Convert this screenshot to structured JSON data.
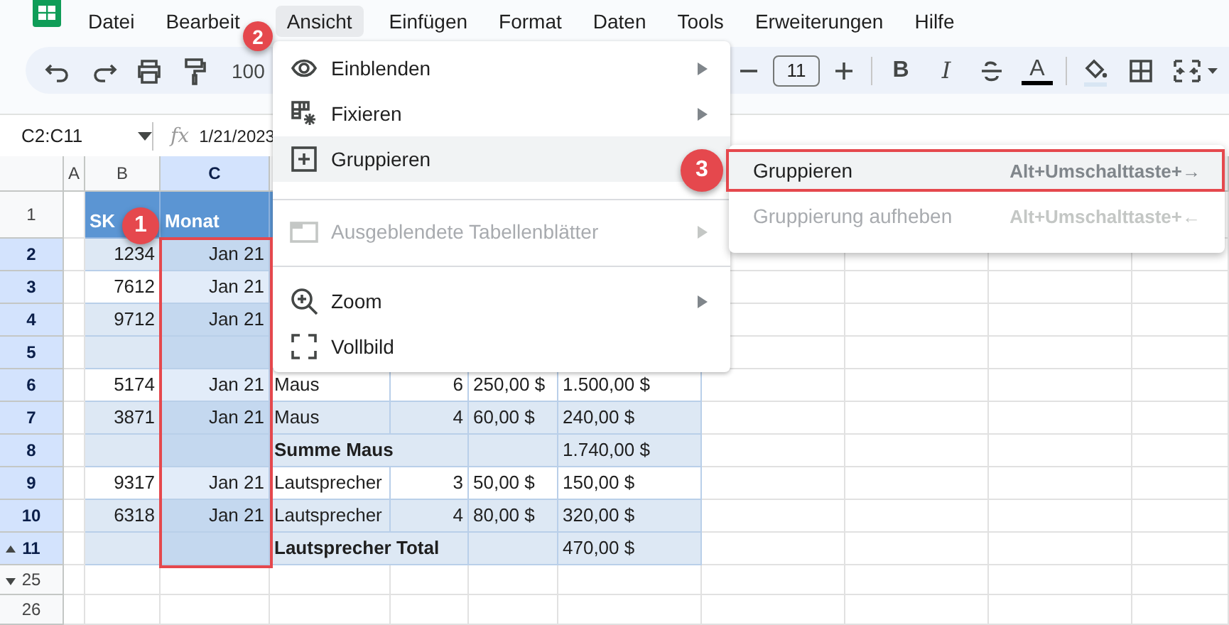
{
  "menubar": {
    "items": [
      {
        "label": "Datei",
        "selected": false
      },
      {
        "label": "Bearbeit",
        "selected": false
      },
      {
        "label": "Ansicht",
        "selected": true
      },
      {
        "label": "Einfügen",
        "selected": false
      },
      {
        "label": "Format",
        "selected": false
      },
      {
        "label": "Daten",
        "selected": false
      },
      {
        "label": "Tools",
        "selected": false
      },
      {
        "label": "Erweiterungen",
        "selected": false
      },
      {
        "label": "Hilfe",
        "selected": false
      }
    ]
  },
  "toolbar": {
    "zoom": "100",
    "font_size": "11",
    "bold": "B",
    "italic": "I",
    "text_color": "A"
  },
  "formula_bar": {
    "name_box": "C2:C11",
    "function_label": "fx",
    "value": "1/21/2023"
  },
  "sheet": {
    "columns": [
      {
        "label": "A",
        "selected": false
      },
      {
        "label": "B",
        "selected": false
      },
      {
        "label": "C",
        "selected": true
      }
    ],
    "rows": [
      {
        "number": "1",
        "kind": "header",
        "selected": false,
        "cells": {
          "B": "SK",
          "C": "Monat"
        }
      },
      {
        "number": "2",
        "kind": "item",
        "selected": true,
        "shaded": true,
        "cells": {
          "B": "1234",
          "C": "Jan 21"
        }
      },
      {
        "number": "3",
        "kind": "item",
        "selected": true,
        "shaded": false,
        "cells": {
          "B": "7612",
          "C": "Jan 21"
        }
      },
      {
        "number": "4",
        "kind": "item",
        "selected": true,
        "shaded": true,
        "cells": {
          "B": "9712",
          "C": "Jan 21"
        }
      },
      {
        "number": "5",
        "kind": "total",
        "selected": true,
        "shaded": true,
        "cells": {}
      },
      {
        "number": "6",
        "kind": "item",
        "selected": true,
        "shaded": false,
        "cells": {
          "B": "5174",
          "C": "Jan 21",
          "D": "Maus",
          "E": "6",
          "F": "250,00 $",
          "G": "1.500,00 $"
        }
      },
      {
        "number": "7",
        "kind": "item",
        "selected": true,
        "shaded": true,
        "cells": {
          "B": "3871",
          "C": "Jan 21",
          "D": "Maus",
          "E": "4",
          "F": "60,00 $",
          "G": "240,00 $"
        }
      },
      {
        "number": "8",
        "kind": "total",
        "selected": true,
        "shaded": true,
        "cells": {
          "D": "Summe Maus",
          "G": "1.740,00 $"
        }
      },
      {
        "number": "9",
        "kind": "item",
        "selected": true,
        "shaded": false,
        "cells": {
          "B": "9317",
          "C": "Jan 21",
          "D": "Lautsprecher",
          "E": "3",
          "F": "50,00 $",
          "G": "150,00 $"
        }
      },
      {
        "number": "10",
        "kind": "item",
        "selected": true,
        "shaded": true,
        "cells": {
          "B": "6318",
          "C": "Jan 21",
          "D": "Lautsprecher",
          "E": "4",
          "F": "80,00 $",
          "G": "320,00 $"
        }
      },
      {
        "number": "11",
        "kind": "total",
        "selected": true,
        "shaded": true,
        "group_expanded": true,
        "cells": {
          "D": "Lautsprecher Total",
          "G": "470,00 $"
        }
      },
      {
        "number": "25",
        "kind": "plain",
        "selected": false,
        "group_expanded": false,
        "cells": {}
      },
      {
        "number": "26",
        "kind": "plain",
        "selected": false,
        "cells": {}
      }
    ]
  },
  "view_menu": {
    "items": [
      {
        "kind": "item",
        "label": "Einblenden",
        "has_submenu": true,
        "disabled": false,
        "selected": false
      },
      {
        "kind": "item",
        "label": "Fixieren",
        "has_submenu": true,
        "disabled": false,
        "selected": false
      },
      {
        "kind": "item",
        "label": "Gruppieren",
        "has_submenu": false,
        "disabled": false,
        "selected": true
      },
      {
        "kind": "divider"
      },
      {
        "kind": "item",
        "label": "Ausgeblendete Tabellenblätter",
        "has_submenu": true,
        "disabled": true,
        "selected": false
      },
      {
        "kind": "divider"
      },
      {
        "kind": "item",
        "label": "Zoom",
        "has_submenu": true,
        "disabled": false,
        "selected": false
      },
      {
        "kind": "item",
        "label": "Vollbild",
        "has_submenu": false,
        "disabled": false,
        "selected": false
      }
    ]
  },
  "group_submenu": {
    "items": [
      {
        "label": "Gruppieren",
        "shortcut": "Alt+Umschalttaste+→",
        "disabled": false,
        "selected": true
      },
      {
        "label": "Gruppierung aufheben",
        "shortcut": "Alt+Umschalttaste+←",
        "disabled": true,
        "selected": false
      }
    ]
  },
  "callouts": [
    {
      "number": "1"
    },
    {
      "number": "2"
    },
    {
      "number": "3"
    }
  ]
}
